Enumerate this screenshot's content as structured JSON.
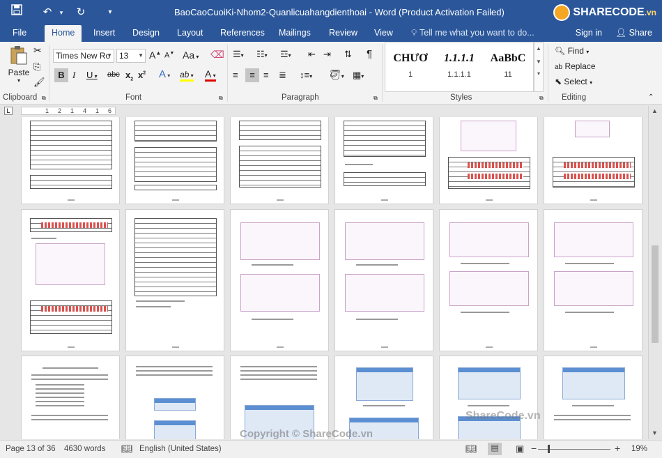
{
  "window": {
    "title": "BaoCaoCuoiKi-Nhom2-Quanlicuahangdienthoai - Word (Product Activation Failed)",
    "brand": "SHARECODE",
    "brand_suffix": ".vn"
  },
  "tabs": {
    "file": "File",
    "home": "Home",
    "insert": "Insert",
    "design": "Design",
    "layout": "Layout",
    "references": "References",
    "mailings": "Mailings",
    "review": "Review",
    "view": "View",
    "tellme": "Tell me what you want to do...",
    "signin": "Sign in",
    "share": "Share"
  },
  "ribbon": {
    "clipboard": {
      "label": "Clipboard",
      "paste": "Paste"
    },
    "font": {
      "label": "Font",
      "family": "Times New Ro",
      "size": "13",
      "grow": "A",
      "shrink": "A",
      "case": "Aa",
      "bold": "B",
      "italic": "I",
      "underline": "U",
      "strike": "abc",
      "sub": "x",
      "sup": "x",
      "effects": "A",
      "highlight": "ab",
      "color": "A"
    },
    "paragraph": {
      "label": "Paragraph"
    },
    "styles": {
      "label": "Styles",
      "items": [
        {
          "sample": "CHƯƠ",
          "name": "1"
        },
        {
          "sample": "1.1.1.1",
          "name": "1.1.1.1"
        },
        {
          "sample": "AaBbC",
          "name": "11"
        }
      ]
    },
    "editing": {
      "label": "Editing",
      "find": "Find",
      "replace": "Replace",
      "select": "Select"
    }
  },
  "ruler": {
    "marks": [
      "1",
      "2",
      "1",
      "4",
      "1",
      "6"
    ]
  },
  "status": {
    "page": "Page 13 of 36",
    "words": "4630 words",
    "language": "English (United States)",
    "zoom": "19%",
    "zoom_percent": 19
  },
  "watermark": {
    "line1": "ShareCode.vn",
    "line2": "Copyright © ShareCode.vn"
  },
  "colors": {
    "accent": "#2b579a",
    "ribbon": "#f3f3f3",
    "doc_bg": "#e6e6e6"
  }
}
